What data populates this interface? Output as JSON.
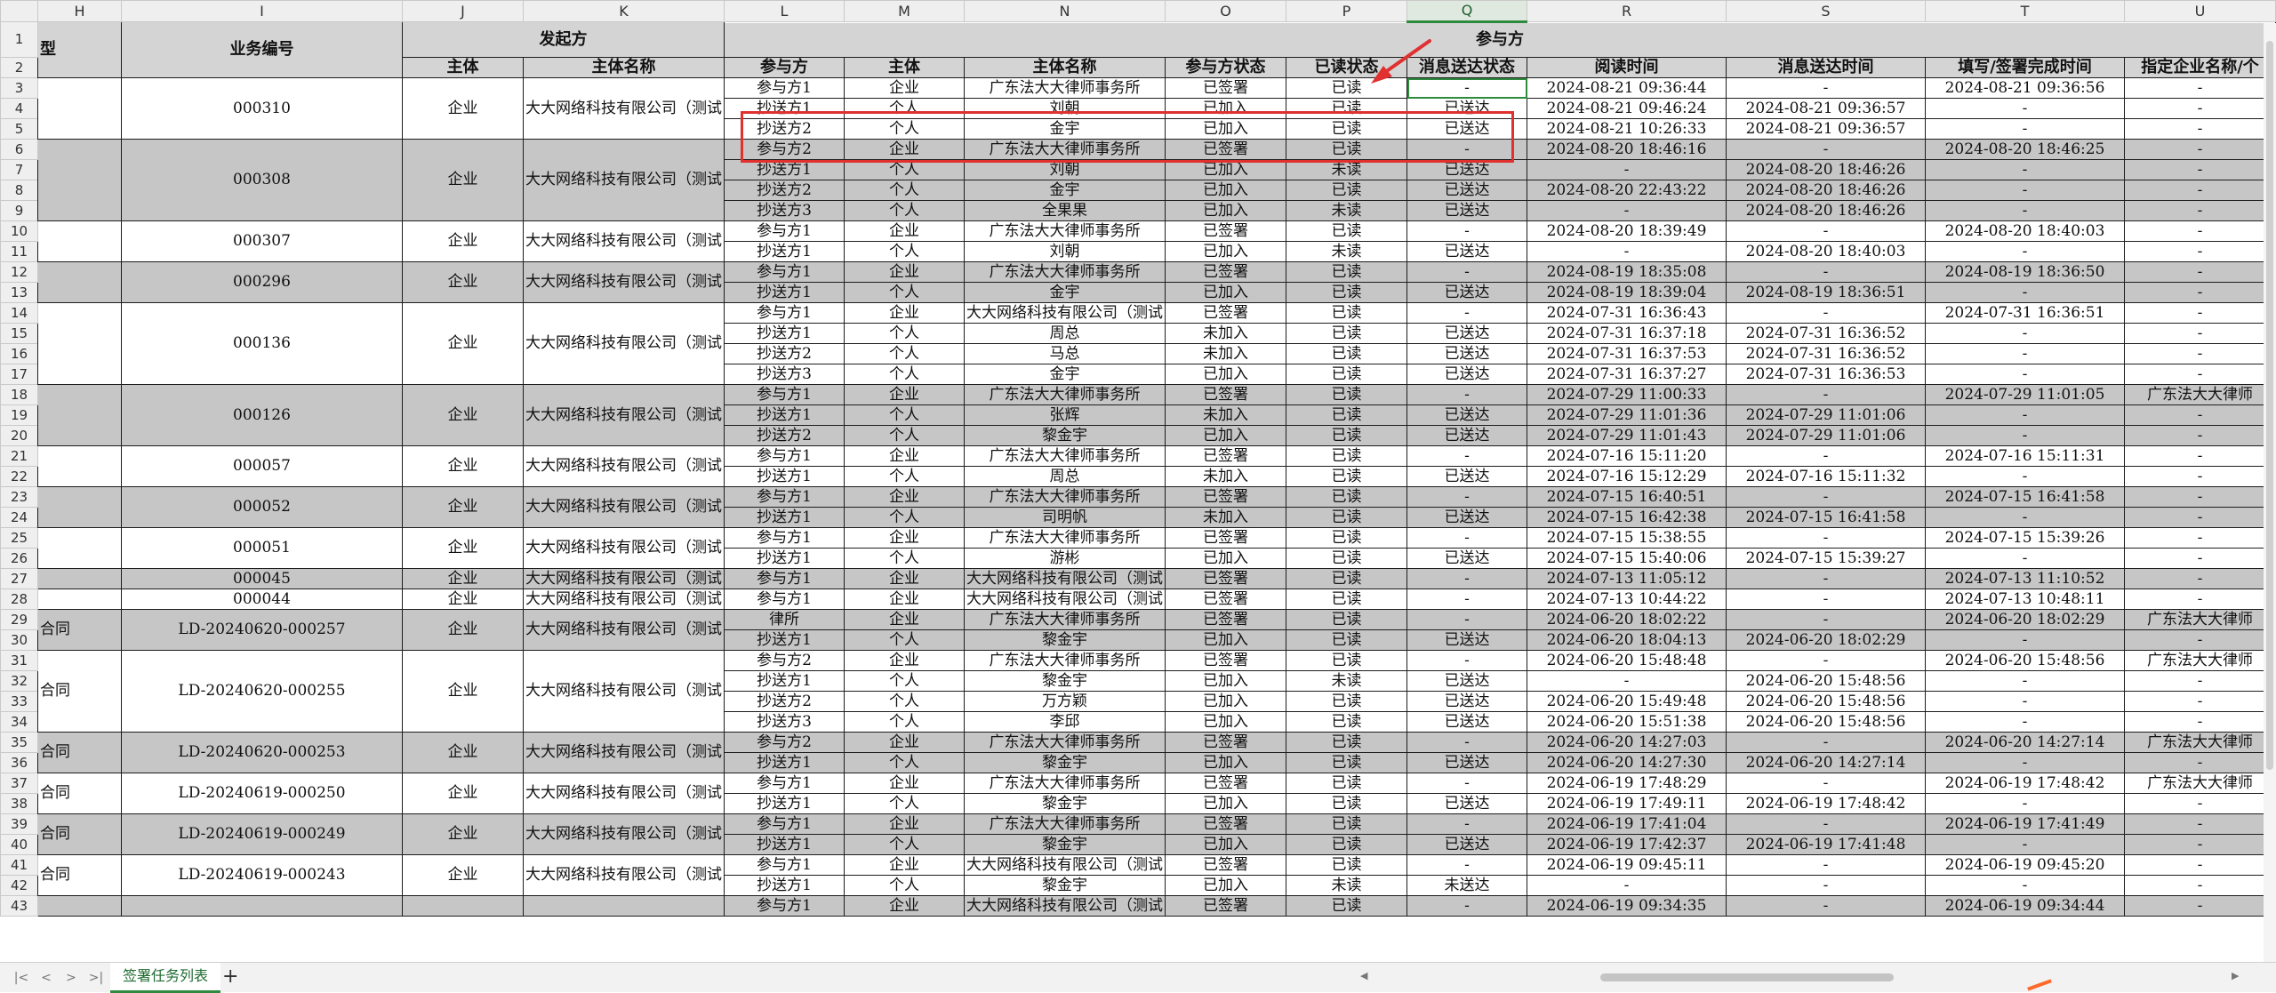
{
  "sheet": {
    "tab_label": "签署任务列表",
    "add_tab_label": "+",
    "selected_column": "Q",
    "col_letters": [
      "H",
      "I",
      "J",
      "K",
      "L",
      "M",
      "N",
      "O",
      "P",
      "Q",
      "R",
      "S",
      "T",
      "U"
    ]
  },
  "headers": {
    "group_initiator": "发起方",
    "group_participant": "参与方",
    "h_type": "型",
    "i_business_no": "业务编号",
    "j_entity": "主体",
    "k_entity_name": "主体名称",
    "l_party": "参与方",
    "m_entity": "主体",
    "n_entity_name": "主体名称",
    "o_party_status": "参与方状态",
    "p_read_status": "已读状态",
    "q_msg_status": "消息送达状态",
    "r_read_time": "阅读时间",
    "s_msg_time": "消息送达时间",
    "t_done_time": "填写/签署完成时间",
    "u_designated": "指定企业名称/个"
  },
  "groups": [
    {
      "start": 3,
      "count": 3,
      "band": false,
      "type": "",
      "biz": "000310",
      "entity": "企业",
      "name": "大大网络科技有限公司（测试"
    },
    {
      "start": 6,
      "count": 4,
      "band": true,
      "type": "",
      "biz": "000308",
      "entity": "企业",
      "name": "大大网络科技有限公司（测试"
    },
    {
      "start": 10,
      "count": 2,
      "band": false,
      "type": "",
      "biz": "000307",
      "entity": "企业",
      "name": "大大网络科技有限公司（测试"
    },
    {
      "start": 12,
      "count": 2,
      "band": true,
      "type": "",
      "biz": "000296",
      "entity": "企业",
      "name": "大大网络科技有限公司（测试"
    },
    {
      "start": 14,
      "count": 4,
      "band": false,
      "type": "",
      "biz": "000136",
      "entity": "企业",
      "name": "大大网络科技有限公司（测试"
    },
    {
      "start": 18,
      "count": 3,
      "band": true,
      "type": "",
      "biz": "000126",
      "entity": "企业",
      "name": "大大网络科技有限公司（测试"
    },
    {
      "start": 21,
      "count": 2,
      "band": false,
      "type": "",
      "biz": "000057",
      "entity": "企业",
      "name": "大大网络科技有限公司（测试"
    },
    {
      "start": 23,
      "count": 2,
      "band": true,
      "type": "",
      "biz": "000052",
      "entity": "企业",
      "name": "大大网络科技有限公司（测试"
    },
    {
      "start": 25,
      "count": 2,
      "band": false,
      "type": "",
      "biz": "000051",
      "entity": "企业",
      "name": "大大网络科技有限公司（测试"
    },
    {
      "start": 27,
      "count": 1,
      "band": true,
      "type": "",
      "biz": "000045",
      "entity": "企业",
      "name": "大大网络科技有限公司（测试"
    },
    {
      "start": 28,
      "count": 1,
      "band": false,
      "type": "",
      "biz": "000044",
      "entity": "企业",
      "name": "大大网络科技有限公司（测试"
    },
    {
      "start": 29,
      "count": 2,
      "band": true,
      "type": "合同",
      "biz": "LD-20240620-000257",
      "entity": "企业",
      "name": "大大网络科技有限公司（测试"
    },
    {
      "start": 31,
      "count": 4,
      "band": false,
      "type": "合同",
      "biz": "LD-20240620-000255",
      "entity": "企业",
      "name": "大大网络科技有限公司（测试"
    },
    {
      "start": 35,
      "count": 2,
      "band": true,
      "type": "合同",
      "biz": "LD-20240620-000253",
      "entity": "企业",
      "name": "大大网络科技有限公司（测试"
    },
    {
      "start": 37,
      "count": 2,
      "band": false,
      "type": "合同",
      "biz": "LD-20240619-000250",
      "entity": "企业",
      "name": "大大网络科技有限公司（测试"
    },
    {
      "start": 39,
      "count": 2,
      "band": true,
      "type": "合同",
      "biz": "LD-20240619-000249",
      "entity": "企业",
      "name": "大大网络科技有限公司（测试"
    },
    {
      "start": 41,
      "count": 2,
      "band": false,
      "type": "合同",
      "biz": "LD-20240619-000243",
      "entity": "企业",
      "name": "大大网络科技有限公司（测试"
    },
    {
      "start": 43,
      "count": 1,
      "band": true,
      "type": "",
      "biz": "",
      "entity": "",
      "name": ""
    }
  ],
  "rows": [
    {
      "n": 3,
      "cells": [
        "参与方1",
        "企业",
        "广东法大大律师事务所",
        "已签署",
        "已读",
        "-",
        "2024-08-21 09:36:44",
        "-",
        "2024-08-21 09:36:56",
        "-"
      ]
    },
    {
      "n": 4,
      "cells": [
        "抄送方1",
        "个人",
        "刘朝",
        "已加入",
        "已读",
        "已送达",
        "2024-08-21 09:46:24",
        "2024-08-21 09:36:57",
        "-",
        "-"
      ]
    },
    {
      "n": 5,
      "cells": [
        "抄送方2",
        "个人",
        "金宇",
        "已加入",
        "已读",
        "已送达",
        "2024-08-21 10:26:33",
        "2024-08-21 09:36:57",
        "-",
        "-"
      ]
    },
    {
      "n": 6,
      "cells": [
        "参与方2",
        "企业",
        "广东法大大律师事务所",
        "已签署",
        "已读",
        "-",
        "2024-08-20 18:46:16",
        "-",
        "2024-08-20 18:46:25",
        "-"
      ]
    },
    {
      "n": 7,
      "cells": [
        "抄送方1",
        "个人",
        "刘朝",
        "已加入",
        "未读",
        "已送达",
        "-",
        "2024-08-20 18:46:26",
        "-",
        "-"
      ]
    },
    {
      "n": 8,
      "cells": [
        "抄送方2",
        "个人",
        "金宇",
        "已加入",
        "已读",
        "已送达",
        "2024-08-20 22:43:22",
        "2024-08-20 18:46:26",
        "-",
        "-"
      ]
    },
    {
      "n": 9,
      "cells": [
        "抄送方3",
        "个人",
        "全果果",
        "已加入",
        "未读",
        "已送达",
        "-",
        "2024-08-20 18:46:26",
        "-",
        "-"
      ]
    },
    {
      "n": 10,
      "cells": [
        "参与方1",
        "企业",
        "广东法大大律师事务所",
        "已签署",
        "已读",
        "-",
        "2024-08-20 18:39:49",
        "-",
        "2024-08-20 18:40:03",
        "-"
      ]
    },
    {
      "n": 11,
      "cells": [
        "抄送方1",
        "个人",
        "刘朝",
        "已加入",
        "未读",
        "已送达",
        "-",
        "2024-08-20 18:40:03",
        "-",
        "-"
      ]
    },
    {
      "n": 12,
      "cells": [
        "参与方1",
        "企业",
        "广东法大大律师事务所",
        "已签署",
        "已读",
        "-",
        "2024-08-19 18:35:08",
        "-",
        "2024-08-19 18:36:50",
        "-"
      ]
    },
    {
      "n": 13,
      "cells": [
        "抄送方1",
        "个人",
        "金宇",
        "已加入",
        "已读",
        "已送达",
        "2024-08-19 18:39:04",
        "2024-08-19 18:36:51",
        "-",
        "-"
      ]
    },
    {
      "n": 14,
      "cells": [
        "参与方1",
        "企业",
        "大大网络科技有限公司（测试",
        "已签署",
        "已读",
        "-",
        "2024-07-31 16:36:43",
        "-",
        "2024-07-31 16:36:51",
        "-"
      ]
    },
    {
      "n": 15,
      "cells": [
        "抄送方1",
        "个人",
        "周总",
        "未加入",
        "已读",
        "已送达",
        "2024-07-31 16:37:18",
        "2024-07-31 16:36:52",
        "-",
        "-"
      ]
    },
    {
      "n": 16,
      "cells": [
        "抄送方2",
        "个人",
        "马总",
        "未加入",
        "已读",
        "已送达",
        "2024-07-31 16:37:53",
        "2024-07-31 16:36:52",
        "-",
        "-"
      ]
    },
    {
      "n": 17,
      "cells": [
        "抄送方3",
        "个人",
        "金宇",
        "已加入",
        "已读",
        "已送达",
        "2024-07-31 16:37:27",
        "2024-07-31 16:36:53",
        "-",
        "-"
      ]
    },
    {
      "n": 18,
      "cells": [
        "参与方1",
        "企业",
        "广东法大大律师事务所",
        "已签署",
        "已读",
        "-",
        "2024-07-29 11:00:33",
        "-",
        "2024-07-29 11:01:05",
        "广东法大大律师"
      ]
    },
    {
      "n": 19,
      "cells": [
        "抄送方1",
        "个人",
        "张辉",
        "未加入",
        "已读",
        "已送达",
        "2024-07-29 11:01:36",
        "2024-07-29 11:01:06",
        "-",
        "-"
      ]
    },
    {
      "n": 20,
      "cells": [
        "抄送方2",
        "个人",
        "黎金宇",
        "已加入",
        "已读",
        "已送达",
        "2024-07-29 11:01:43",
        "2024-07-29 11:01:06",
        "-",
        "-"
      ]
    },
    {
      "n": 21,
      "cells": [
        "参与方1",
        "企业",
        "广东法大大律师事务所",
        "已签署",
        "已读",
        "-",
        "2024-07-16 15:11:20",
        "-",
        "2024-07-16 15:11:31",
        "-"
      ]
    },
    {
      "n": 22,
      "cells": [
        "抄送方1",
        "个人",
        "周总",
        "未加入",
        "已读",
        "已送达",
        "2024-07-16 15:12:29",
        "2024-07-16 15:11:32",
        "-",
        "-"
      ]
    },
    {
      "n": 23,
      "cells": [
        "参与方1",
        "企业",
        "广东法大大律师事务所",
        "已签署",
        "已读",
        "-",
        "2024-07-15 16:40:51",
        "-",
        "2024-07-15 16:41:58",
        "-"
      ]
    },
    {
      "n": 24,
      "cells": [
        "抄送方1",
        "个人",
        "司明帆",
        "未加入",
        "已读",
        "已送达",
        "2024-07-15 16:42:38",
        "2024-07-15 16:41:58",
        "-",
        "-"
      ]
    },
    {
      "n": 25,
      "cells": [
        "参与方1",
        "企业",
        "广东法大大律师事务所",
        "已签署",
        "已读",
        "-",
        "2024-07-15 15:38:55",
        "-",
        "2024-07-15 15:39:26",
        "-"
      ]
    },
    {
      "n": 26,
      "cells": [
        "抄送方1",
        "个人",
        "游彬",
        "已加入",
        "已读",
        "已送达",
        "2024-07-15 15:40:06",
        "2024-07-15 15:39:27",
        "-",
        "-"
      ]
    },
    {
      "n": 27,
      "cells": [
        "参与方1",
        "企业",
        "大大网络科技有限公司（测试",
        "已签署",
        "已读",
        "-",
        "2024-07-13 11:05:12",
        "-",
        "2024-07-13 11:10:52",
        "-"
      ]
    },
    {
      "n": 28,
      "cells": [
        "参与方1",
        "企业",
        "大大网络科技有限公司（测试",
        "已签署",
        "已读",
        "-",
        "2024-07-13 10:44:22",
        "-",
        "2024-07-13 10:48:11",
        "-"
      ]
    },
    {
      "n": 29,
      "cells": [
        "律所",
        "企业",
        "广东法大大律师事务所",
        "已签署",
        "已读",
        "-",
        "2024-06-20 18:02:22",
        "-",
        "2024-06-20 18:02:29",
        "广东法大大律师"
      ]
    },
    {
      "n": 30,
      "cells": [
        "抄送方1",
        "个人",
        "黎金宇",
        "已加入",
        "已读",
        "已送达",
        "2024-06-20 18:04:13",
        "2024-06-20 18:02:29",
        "-",
        "-"
      ]
    },
    {
      "n": 31,
      "cells": [
        "参与方2",
        "企业",
        "广东法大大律师事务所",
        "已签署",
        "已读",
        "-",
        "2024-06-20 15:48:48",
        "-",
        "2024-06-20 15:48:56",
        "广东法大大律师"
      ]
    },
    {
      "n": 32,
      "cells": [
        "抄送方1",
        "个人",
        "黎金宇",
        "已加入",
        "未读",
        "已送达",
        "-",
        "2024-06-20 15:48:56",
        "-",
        "-"
      ]
    },
    {
      "n": 33,
      "cells": [
        "抄送方2",
        "个人",
        "万方颖",
        "已加入",
        "已读",
        "已送达",
        "2024-06-20 15:49:48",
        "2024-06-20 15:48:56",
        "-",
        "-"
      ]
    },
    {
      "n": 34,
      "cells": [
        "抄送方3",
        "个人",
        "李邱",
        "已加入",
        "已读",
        "已送达",
        "2024-06-20 15:51:38",
        "2024-06-20 15:48:56",
        "-",
        "-"
      ]
    },
    {
      "n": 35,
      "cells": [
        "参与方2",
        "企业",
        "广东法大大律师事务所",
        "已签署",
        "已读",
        "-",
        "2024-06-20 14:27:03",
        "-",
        "2024-06-20 14:27:14",
        "广东法大大律师"
      ]
    },
    {
      "n": 36,
      "cells": [
        "抄送方1",
        "个人",
        "黎金宇",
        "已加入",
        "已读",
        "已送达",
        "2024-06-20 14:27:30",
        "2024-06-20 14:27:14",
        "-",
        "-"
      ]
    },
    {
      "n": 37,
      "cells": [
        "参与方1",
        "企业",
        "广东法大大律师事务所",
        "已签署",
        "已读",
        "-",
        "2024-06-19 17:48:29",
        "-",
        "2024-06-19 17:48:42",
        "广东法大大律师"
      ]
    },
    {
      "n": 38,
      "cells": [
        "抄送方1",
        "个人",
        "黎金宇",
        "已加入",
        "已读",
        "已送达",
        "2024-06-19 17:49:11",
        "2024-06-19 17:48:42",
        "-",
        "-"
      ]
    },
    {
      "n": 39,
      "cells": [
        "参与方1",
        "企业",
        "广东法大大律师事务所",
        "已签署",
        "已读",
        "-",
        "2024-06-19 17:41:04",
        "-",
        "2024-06-19 17:41:49",
        "-"
      ]
    },
    {
      "n": 40,
      "cells": [
        "抄送方1",
        "个人",
        "黎金宇",
        "已加入",
        "已读",
        "已送达",
        "2024-06-19 17:42:37",
        "2024-06-19 17:41:48",
        "-",
        "-"
      ]
    },
    {
      "n": 41,
      "cells": [
        "参与方1",
        "企业",
        "大大网络科技有限公司（测试",
        "已签署",
        "已读",
        "-",
        "2024-06-19 09:45:11",
        "-",
        "2024-06-19 09:45:20",
        "-"
      ]
    },
    {
      "n": 42,
      "cells": [
        "抄送方1",
        "个人",
        "黎金宇",
        "已加入",
        "未读",
        "未送达",
        "-",
        "-",
        "-",
        "-"
      ]
    },
    {
      "n": 43,
      "cells": [
        "参与方1",
        "企业",
        "大大网络科技有限公司（测试",
        "已签署",
        "已读",
        "-",
        "2024-06-19 09:34:35",
        "-",
        "2024-06-19 09:34:44",
        "-"
      ]
    }
  ],
  "colors": {
    "band": "#c6c6c6",
    "header": "#d4d4d4",
    "accent_green": "#2e8b3e",
    "annotation_red": "#e03030"
  }
}
